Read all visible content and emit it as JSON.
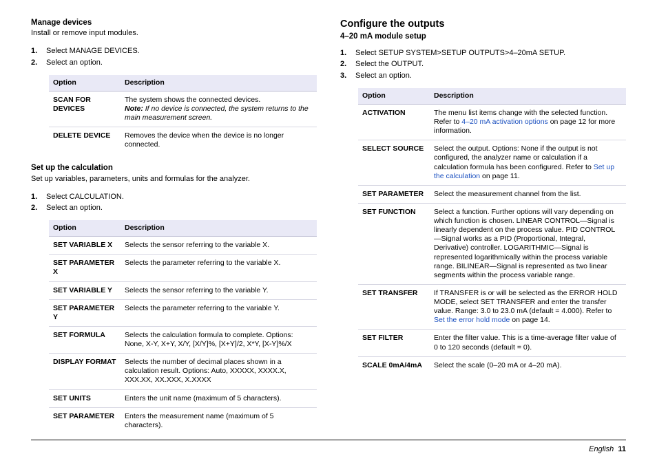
{
  "left": {
    "section1": {
      "heading": "Manage devices",
      "intro": "Install or remove input modules.",
      "steps": [
        "Select MANAGE DEVICES.",
        "Select an option."
      ],
      "thead": {
        "opt": "Option",
        "desc": "Description"
      },
      "rows": [
        {
          "opt": "SCAN FOR DEVICES",
          "desc_pre": "The system shows the connected devices.",
          "desc_note_label": "Note:",
          "desc_note_body": " If no device is connected, the system returns to the main measurement screen."
        },
        {
          "opt": "DELETE DEVICE",
          "desc": "Removes the device when the device is no longer connected."
        }
      ]
    },
    "section2": {
      "heading": "Set up the calculation",
      "intro": "Set up variables, parameters, units and formulas for the analyzer.",
      "steps": [
        "Select CALCULATION.",
        "Select an option."
      ],
      "thead": {
        "opt": "Option",
        "desc": "Description"
      },
      "rows": [
        {
          "opt": "SET VARIABLE X",
          "desc": "Selects the sensor referring to the variable X."
        },
        {
          "opt": "SET PARAMETER X",
          "desc": "Selects the parameter referring to the variable X."
        },
        {
          "opt": "SET VARIABLE Y",
          "desc": "Selects the sensor referring to the variable Y."
        },
        {
          "opt": "SET PARAMETER Y",
          "desc": "Selects the parameter referring to the variable Y."
        },
        {
          "opt": "SET FORMULA",
          "desc": "Selects the calculation formula to complete. Options: None, X-Y, X+Y, X/Y, [X/Y]%, [X+Y]/2, X*Y, [X-Y]%/X"
        },
        {
          "opt": "DISPLAY FORMAT",
          "desc": "Selects the number of decimal places shown in a calculation result. Options: Auto, XXXXX, XXXX.X, XXX.XX, XX.XXX, X.XXXX"
        },
        {
          "opt": "SET UNITS",
          "desc": "Enters the unit name (maximum of 5 characters)."
        },
        {
          "opt": "SET PARAMETER",
          "desc": "Enters the measurement name (maximum of 5 characters)."
        }
      ]
    }
  },
  "right": {
    "heading": "Configure the outputs",
    "sub": "4–20 mA module setup",
    "steps": [
      "Select SETUP SYSTEM>SETUP OUTPUTS>4–20mA SETUP.",
      "Select the OUTPUT.",
      "Select an option."
    ],
    "thead": {
      "opt": "Option",
      "desc": "Description"
    },
    "rows": {
      "activation": {
        "opt": "ACTIVATION",
        "d1": "The menu list items change with the selected function. Refer to ",
        "link": "4–20 mA activation options",
        "d2": " on page 12 for more information."
      },
      "select_source": {
        "opt": "SELECT SOURCE",
        "d1": "Select the output. Options: None if the output is not configured, the analyzer name or calculation if a calculation formula has been configured. Refer to ",
        "link": "Set up the calculation",
        "d2": " on page 11."
      },
      "set_parameter": {
        "opt": "SET PARAMETER",
        "desc": "Select the measurement channel from the list."
      },
      "set_function": {
        "opt": "SET FUNCTION",
        "desc": "Select a function. Further options will vary depending on which function is chosen. LINEAR CONTROL—Signal is linearly dependent on the process value. PID CONTROL—Signal works as a PID (Proportional, Integral, Derivative) controller. LOGARITHMIC—Signal is represented logarithmically within the process variable range. BILINEAR—Signal is represented as two linear segments within the process variable range."
      },
      "set_transfer": {
        "opt": "SET TRANSFER",
        "d1": "If TRANSFER is or will be selected as the ERROR HOLD MODE, select SET TRANSFER and enter the transfer value. Range: 3.0 to 23.0 mA (default = 4.000). Refer to ",
        "link": "Set the error hold mode",
        "d2": " on page 14."
      },
      "set_filter": {
        "opt": "SET FILTER",
        "desc": "Enter the filter value. This is a time-average filter value of 0 to 120 seconds (default = 0)."
      },
      "scale": {
        "opt": "SCALE 0mA/4mA",
        "desc": "Select the scale (0–20 mA or 4–20 mA)."
      }
    }
  },
  "footer": {
    "lang": "English",
    "page": "11"
  }
}
